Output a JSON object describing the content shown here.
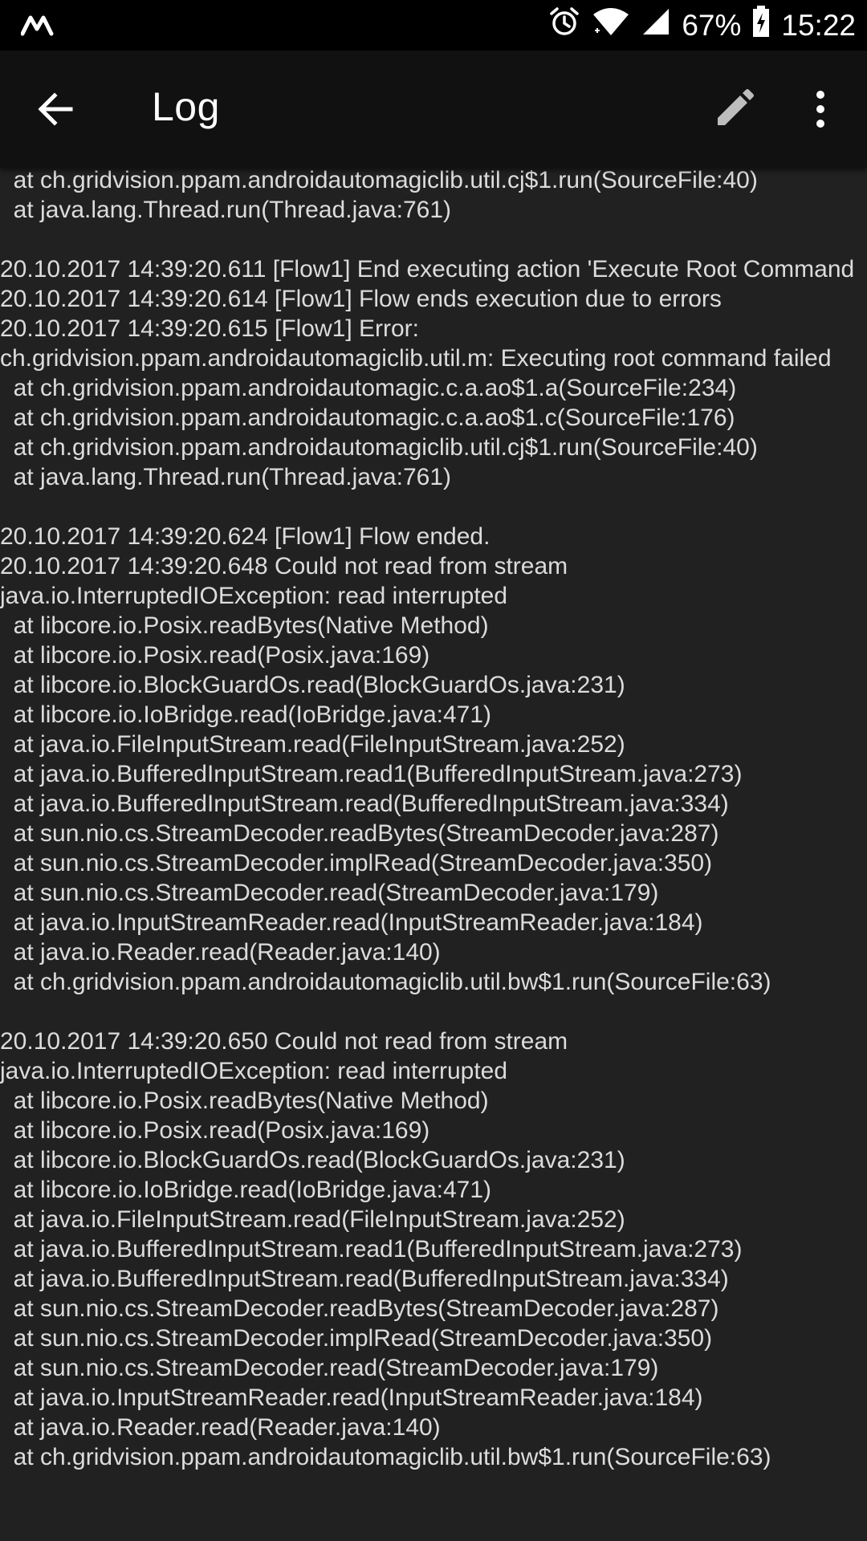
{
  "status_bar": {
    "app_icon": "m-logo-icon",
    "alarm_icon": "alarm-clock-icon",
    "wifi_icon": "wifi-icon",
    "signal_icon": "cell-signal-icon",
    "battery_percent": "67%",
    "battery_icon": "battery-charging-icon",
    "time": "15:22"
  },
  "app_bar": {
    "back_icon": "arrow-back-icon",
    "title": "Log",
    "edit_icon": "pencil-icon",
    "more_icon": "more-vert-icon"
  },
  "log": {
    "lines": [
      "  at ch.gridvision.ppam.androidautomagiclib.util.cj$1.run(SourceFile:40)",
      "  at ch.gridvision.ppam.androidautomagiclib.util.cj$1.run(SourceFile:40)",
      "  at java.lang.Thread.run(Thread.java:761)",
      "",
      "20.10.2017 14:39:20.611 [Flow1] End executing action 'Execute Root Command",
      "20.10.2017 14:39:20.614 [Flow1] Flow ends execution due to errors",
      "20.10.2017 14:39:20.615 [Flow1] Error:",
      "ch.gridvision.ppam.androidautomagiclib.util.m: Executing root command failed",
      "  at ch.gridvision.ppam.androidautomagic.c.a.ao$1.a(SourceFile:234)",
      "  at ch.gridvision.ppam.androidautomagic.c.a.ao$1.c(SourceFile:176)",
      "  at ch.gridvision.ppam.androidautomagiclib.util.cj$1.run(SourceFile:40)",
      "  at java.lang.Thread.run(Thread.java:761)",
      "",
      "20.10.2017 14:39:20.624 [Flow1] Flow ended.",
      "20.10.2017 14:39:20.648 Could not read from stream",
      "java.io.InterruptedIOException: read interrupted",
      "  at libcore.io.Posix.readBytes(Native Method)",
      "  at libcore.io.Posix.read(Posix.java:169)",
      "  at libcore.io.BlockGuardOs.read(BlockGuardOs.java:231)",
      "  at libcore.io.IoBridge.read(IoBridge.java:471)",
      "  at java.io.FileInputStream.read(FileInputStream.java:252)",
      "  at java.io.BufferedInputStream.read1(BufferedInputStream.java:273)",
      "  at java.io.BufferedInputStream.read(BufferedInputStream.java:334)",
      "  at sun.nio.cs.StreamDecoder.readBytes(StreamDecoder.java:287)",
      "  at sun.nio.cs.StreamDecoder.implRead(StreamDecoder.java:350)",
      "  at sun.nio.cs.StreamDecoder.read(StreamDecoder.java:179)",
      "  at java.io.InputStreamReader.read(InputStreamReader.java:184)",
      "  at java.io.Reader.read(Reader.java:140)",
      "  at ch.gridvision.ppam.androidautomagiclib.util.bw$1.run(SourceFile:63)",
      "",
      "20.10.2017 14:39:20.650 Could not read from stream",
      "java.io.InterruptedIOException: read interrupted",
      "  at libcore.io.Posix.readBytes(Native Method)",
      "  at libcore.io.Posix.read(Posix.java:169)",
      "  at libcore.io.BlockGuardOs.read(BlockGuardOs.java:231)",
      "  at libcore.io.IoBridge.read(IoBridge.java:471)",
      "  at java.io.FileInputStream.read(FileInputStream.java:252)",
      "  at java.io.BufferedInputStream.read1(BufferedInputStream.java:273)",
      "  at java.io.BufferedInputStream.read(BufferedInputStream.java:334)",
      "  at sun.nio.cs.StreamDecoder.readBytes(StreamDecoder.java:287)",
      "  at sun.nio.cs.StreamDecoder.implRead(StreamDecoder.java:350)",
      "  at sun.nio.cs.StreamDecoder.read(StreamDecoder.java:179)",
      "  at java.io.InputStreamReader.read(InputStreamReader.java:184)",
      "  at java.io.Reader.read(Reader.java:140)",
      "  at ch.gridvision.ppam.androidautomagiclib.util.bw$1.run(SourceFile:63)"
    ]
  },
  "colors": {
    "status_bar_bg": "#000000",
    "app_bar_bg": "#111111",
    "log_bg": "#212121",
    "log_text": "#dcdcdc",
    "icon": "#ffffff",
    "edit_icon": "#bdbdbd"
  }
}
